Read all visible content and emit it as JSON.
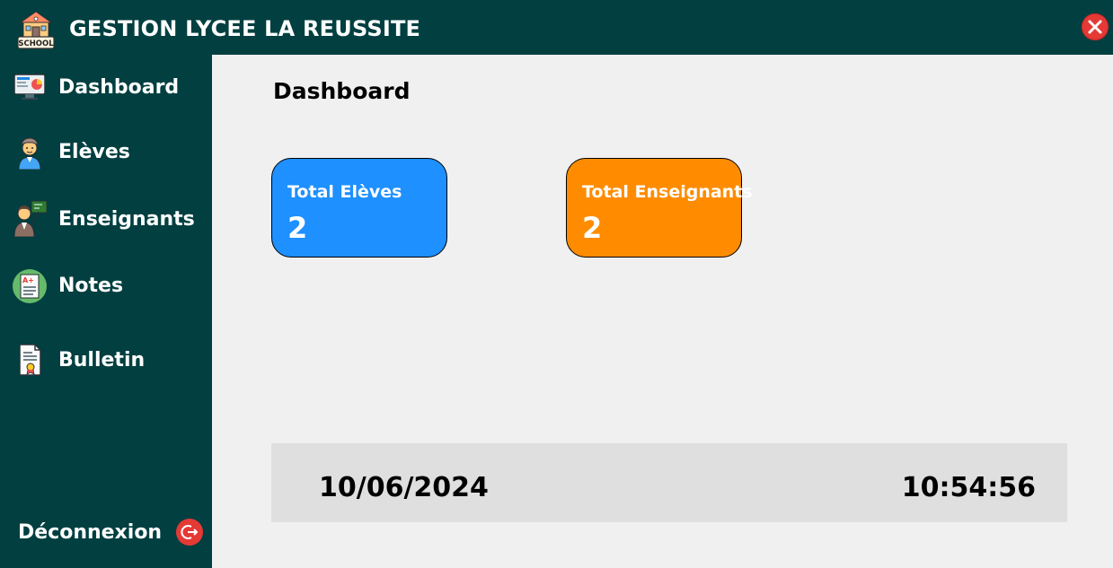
{
  "app": {
    "title": "GESTION LYCEE LA REUSSITE",
    "logo_text": "SCHOOL"
  },
  "sidebar": {
    "items": [
      {
        "label": "Dashboard",
        "icon": "dashboard-monitor-icon"
      },
      {
        "label": "Elèves",
        "icon": "student-icon"
      },
      {
        "label": "Enseignants",
        "icon": "teacher-icon"
      },
      {
        "label": "Notes",
        "icon": "grades-icon"
      },
      {
        "label": "Bulletin",
        "icon": "report-card-icon"
      }
    ],
    "logout_label": "Déconnexion"
  },
  "main": {
    "page_title": "Dashboard",
    "cards": [
      {
        "label": "Total Elèves",
        "value": "2",
        "color": "#1e90ff"
      },
      {
        "label": "Total Enseignants",
        "value": "2",
        "color": "#ff8c00"
      }
    ],
    "status": {
      "date": "10/06/2024",
      "time": "10:54:56"
    }
  },
  "colors": {
    "sidebar_bg": "#013f40",
    "close": "#e53935",
    "main_bg": "#f0f0f0"
  }
}
